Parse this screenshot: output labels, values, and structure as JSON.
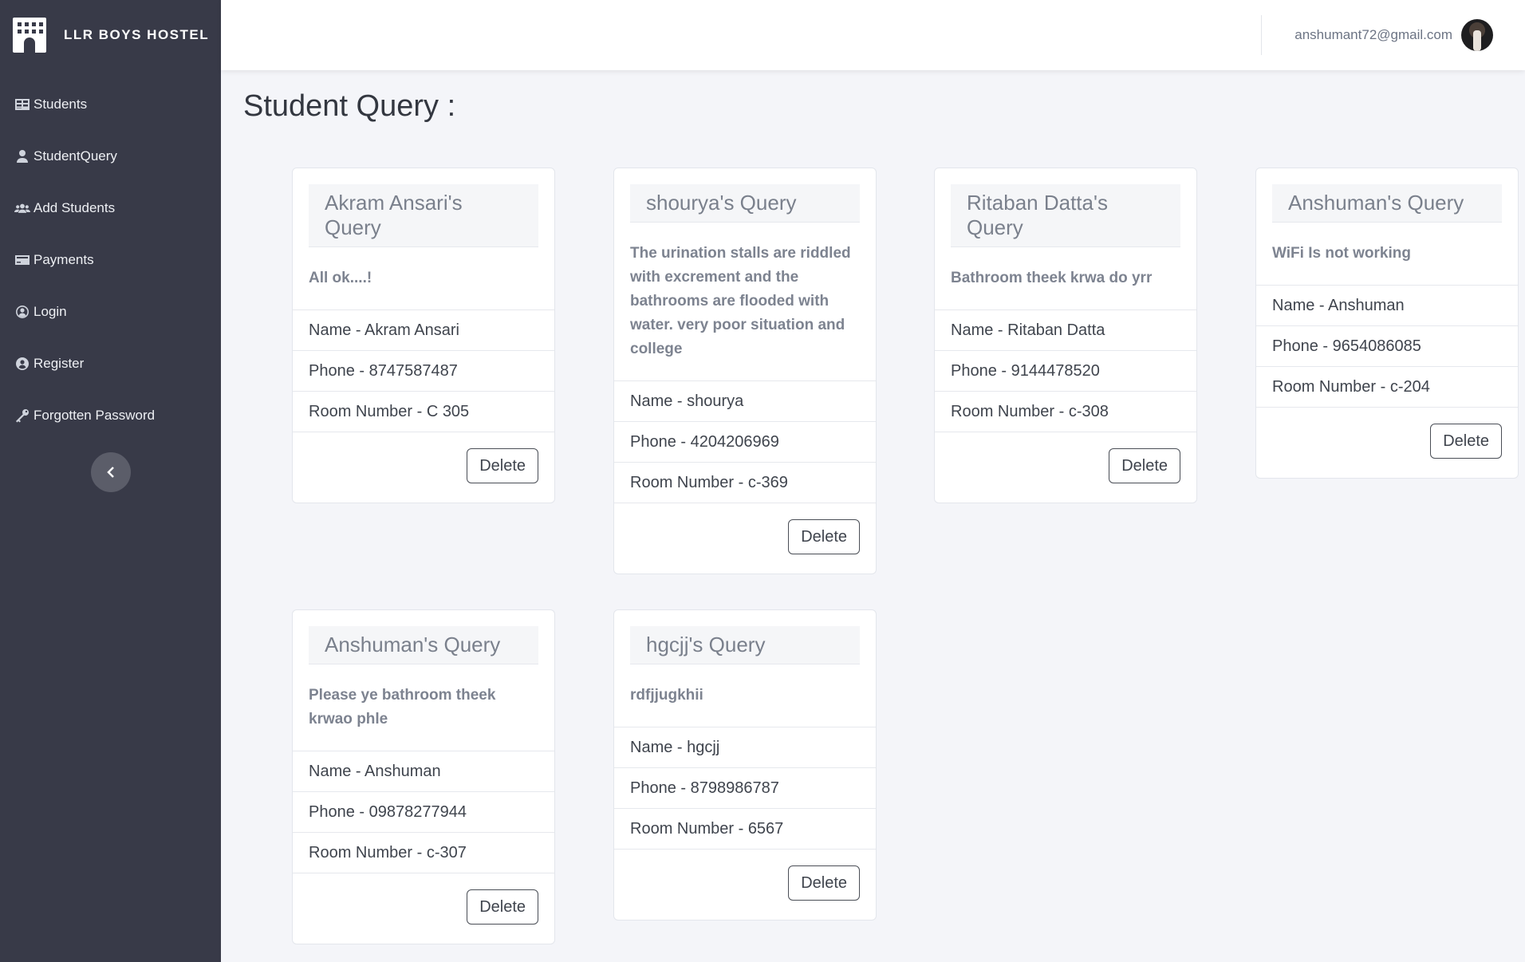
{
  "app": {
    "brand": "LLR BOYS HOSTEL"
  },
  "sidebar": {
    "items": [
      {
        "label": "Students",
        "icon": "table-icon"
      },
      {
        "label": "StudentQuery",
        "icon": "user-icon"
      },
      {
        "label": "Add Students",
        "icon": "users-icon"
      },
      {
        "label": "Payments",
        "icon": "credit-card-icon"
      },
      {
        "label": "Login",
        "icon": "user-circle-icon"
      },
      {
        "label": "Register",
        "icon": "user-circle-filled-icon"
      },
      {
        "label": "Forgotten Password",
        "icon": "key-icon"
      }
    ],
    "toggle_icon": "chevron-left-icon"
  },
  "topbar": {
    "user_email": "anshumant72@gmail.com"
  },
  "page": {
    "title": "Student Query :"
  },
  "queries": [
    {
      "title": "Akram Ansari's Query",
      "message": "All ok....!",
      "name": "Name - Akram Ansari",
      "phone": "Phone - 8747587487",
      "room": "Room Number - C 305",
      "delete": "Delete"
    },
    {
      "title": "shourya's Query",
      "message": "The urination stalls are riddled with excrement and the bathrooms are flooded with water. very poor situation and college",
      "name": "Name - shourya",
      "phone": "Phone - 4204206969",
      "room": "Room Number - c-369",
      "delete": "Delete"
    },
    {
      "title": "Ritaban Datta's Query",
      "message": "Bathroom theek krwa do yrr",
      "name": "Name - Ritaban Datta",
      "phone": "Phone - 9144478520",
      "room": "Room Number - c-308",
      "delete": "Delete"
    },
    {
      "title": "Anshuman's Query",
      "message": "WiFi Is not working",
      "name": "Name - Anshuman",
      "phone": "Phone - 9654086085",
      "room": "Room Number - c-204",
      "delete": "Delete"
    },
    {
      "title": "Anshuman's Query",
      "message": "Please ye bathroom theek krwao phle",
      "name": "Name - Anshuman",
      "phone": "Phone - 09878277944",
      "room": "Room Number - c-307",
      "delete": "Delete"
    },
    {
      "title": "hgcjj's Query",
      "message": "rdfjjugkhii",
      "name": "Name - hgcjj",
      "phone": "Phone - 8798986787",
      "room": "Room Number - 6567",
      "delete": "Delete"
    }
  ]
}
